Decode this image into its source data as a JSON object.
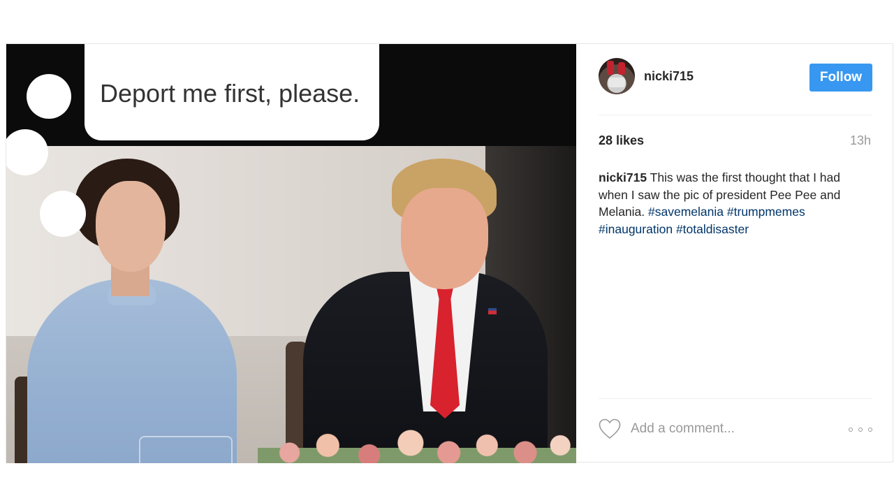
{
  "meme": {
    "bubble_text": "Deport me first, please."
  },
  "post": {
    "username": "nicki715",
    "follow_label": "Follow",
    "likes": "28 likes",
    "time": "13h",
    "caption": {
      "username": "nicki715",
      "text": "This was the first thought that I had when I saw the pic of president Pee Pee and Melania.",
      "hashtags": [
        "#savemelania",
        "#trumpmemes",
        "#inauguration",
        "#totaldisaster"
      ]
    },
    "comment_placeholder": "Add a comment...",
    "icons": {
      "like": "heart-icon",
      "more": "more-options-icon"
    },
    "colors": {
      "follow_button": "#3897f0",
      "hashtag": "#003569",
      "muted_text": "#999999",
      "primary_text": "#262626"
    }
  }
}
